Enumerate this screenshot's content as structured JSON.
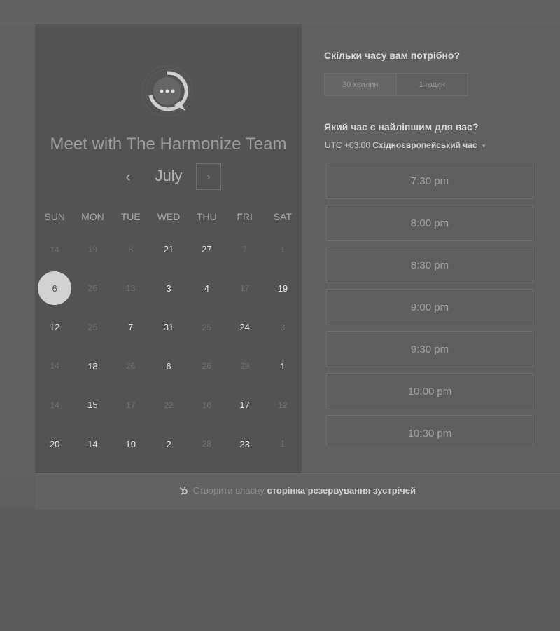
{
  "header": {
    "title": "Meet with The Harmonize Team",
    "logo_icon": "chat-bubble-icon"
  },
  "calendar": {
    "month": "July",
    "prev_icon": "‹",
    "next_icon": "›",
    "weekdays": [
      "SUN",
      "MON",
      "TUE",
      "WED",
      "THU",
      "FRI",
      "SAT"
    ],
    "days": [
      {
        "n": "14",
        "muted": true
      },
      {
        "n": "19",
        "muted": true
      },
      {
        "n": "8",
        "muted": true
      },
      {
        "n": "21",
        "muted": false
      },
      {
        "n": "27",
        "muted": false
      },
      {
        "n": "7",
        "muted": true
      },
      {
        "n": "1",
        "muted": true
      },
      {
        "n": "6",
        "muted": false,
        "selected": true
      },
      {
        "n": "26",
        "muted": true
      },
      {
        "n": "13",
        "muted": true
      },
      {
        "n": "3",
        "muted": false
      },
      {
        "n": "4",
        "muted": false
      },
      {
        "n": "17",
        "muted": true
      },
      {
        "n": "19",
        "muted": false
      },
      {
        "n": "12",
        "muted": false
      },
      {
        "n": "25",
        "muted": true
      },
      {
        "n": "7",
        "muted": false
      },
      {
        "n": "31",
        "muted": false
      },
      {
        "n": "25",
        "muted": true
      },
      {
        "n": "24",
        "muted": false
      },
      {
        "n": "3",
        "muted": true
      },
      {
        "n": "14",
        "muted": true
      },
      {
        "n": "18",
        "muted": false
      },
      {
        "n": "26",
        "muted": true
      },
      {
        "n": "6",
        "muted": false
      },
      {
        "n": "26",
        "muted": true
      },
      {
        "n": "29",
        "muted": true
      },
      {
        "n": "1",
        "muted": false
      },
      {
        "n": "14",
        "muted": true
      },
      {
        "n": "15",
        "muted": false
      },
      {
        "n": "17",
        "muted": true
      },
      {
        "n": "22",
        "muted": true
      },
      {
        "n": "10",
        "muted": true
      },
      {
        "n": "17",
        "muted": false
      },
      {
        "n": "12",
        "muted": true
      },
      {
        "n": "20",
        "muted": false
      },
      {
        "n": "14",
        "muted": false
      },
      {
        "n": "10",
        "muted": false
      },
      {
        "n": "2",
        "muted": false
      },
      {
        "n": "28",
        "muted": true
      },
      {
        "n": "23",
        "muted": false
      },
      {
        "n": "1",
        "muted": true
      }
    ]
  },
  "duration": {
    "question": "Скільки часу вам потрібно?",
    "options": [
      "30 хвилин",
      "1 годин"
    ],
    "selected": "30 хвилин"
  },
  "time": {
    "question": "Який час є найліпшим для вас?",
    "tz_offset": "UTC +03:00",
    "tz_name": "Східноєвропейський час",
    "tz_caret_icon": "▾",
    "slots": [
      "7:30 pm",
      "8:00 pm",
      "8:30 pm",
      "9:00 pm",
      "9:30 pm",
      "10:00 pm",
      "10:30 pm"
    ]
  },
  "footer": {
    "prefix": "Створити власну",
    "link": "сторінка резервування зустрічей",
    "icon": "hubspot-sprocket-icon"
  },
  "colors": {
    "selected_day": "#d2d2d2",
    "left_panel": "#535353",
    "right_panel": "#606060"
  }
}
